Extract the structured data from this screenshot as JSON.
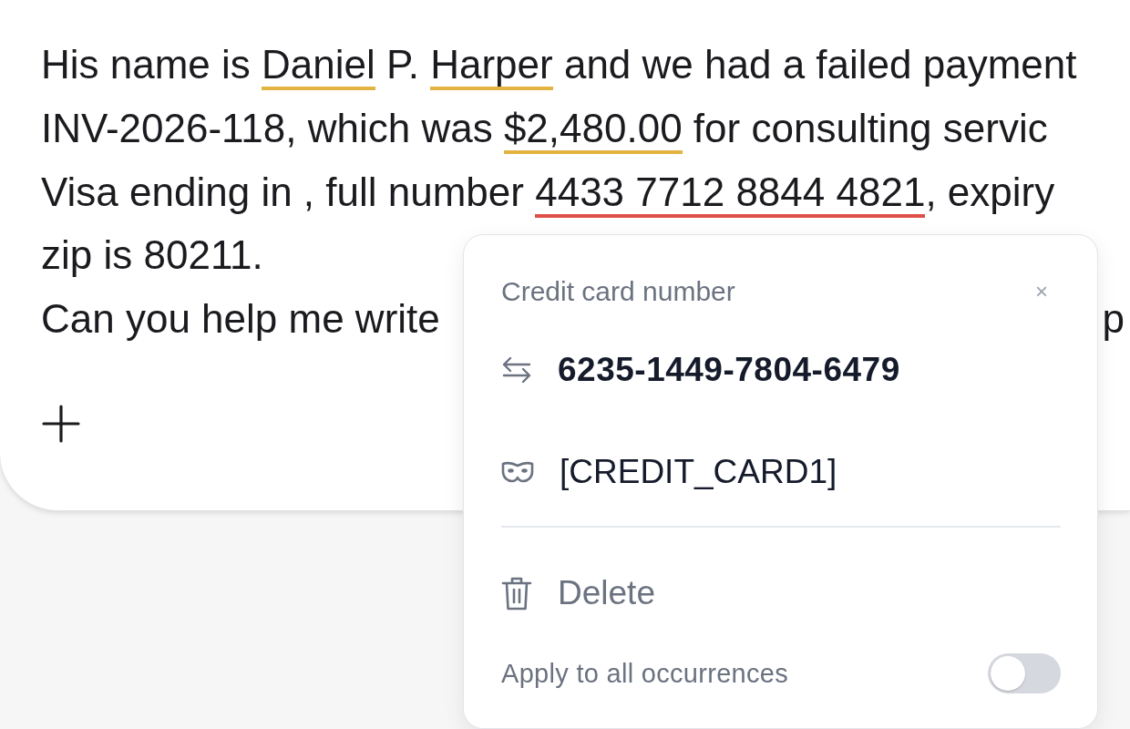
{
  "message": {
    "lines": [
      {
        "segments": [
          {
            "text": "His name is ",
            "kind": "plain"
          },
          {
            "text": "Daniel",
            "kind": "entity",
            "color": "#e3b341"
          },
          {
            "text": " P. ",
            "kind": "plain"
          },
          {
            "text": "Harper",
            "kind": "entity",
            "color": "#e3b341"
          },
          {
            "text": " and we had a failed payment",
            "kind": "plain"
          }
        ]
      },
      {
        "segments": [
          {
            "text": "INV-2026-118, which was ",
            "kind": "plain"
          },
          {
            "text": "$2,480.00",
            "kind": "entity",
            "color": "#e3b341"
          },
          {
            "text": " for consulting servic",
            "kind": "plain"
          }
        ]
      },
      {
        "segments": [
          {
            "text": "Visa ending in , full number ",
            "kind": "plain"
          },
          {
            "text": "4433 7712 8844 4821",
            "kind": "entity",
            "color": "#e0504a"
          },
          {
            "text": ", expiry",
            "kind": "plain"
          }
        ]
      },
      {
        "segments": [
          {
            "text": "zip is 80211.",
            "kind": "plain"
          }
        ]
      },
      {
        "segments": [
          {
            "text": "Can you help me write",
            "kind": "plain"
          },
          {
            "text": "p",
            "kind": "tail"
          }
        ]
      }
    ]
  },
  "popup": {
    "title": "Credit card number",
    "close": "×",
    "replacement": "6235-1449-7804-6479",
    "token": "[CREDIT_CARD1]",
    "delete": "Delete",
    "apply_all": {
      "label": "Apply to all occurrences",
      "on": false
    }
  }
}
